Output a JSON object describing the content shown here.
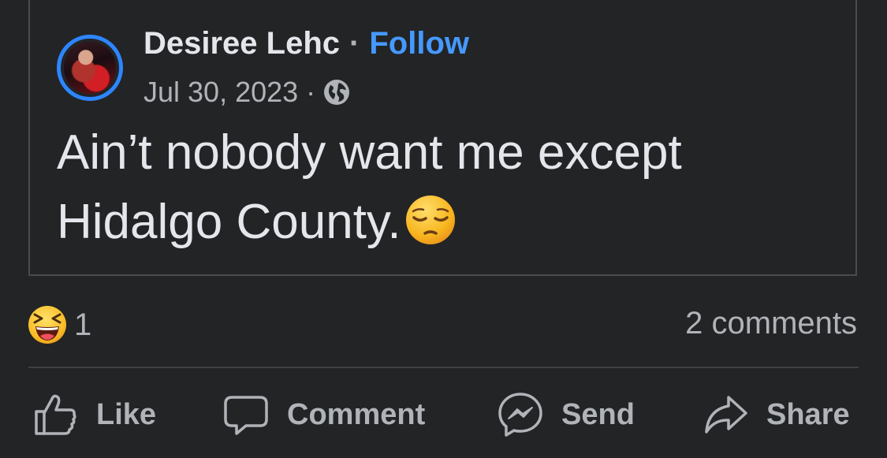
{
  "post": {
    "author": "Desiree Lehc",
    "separator": "·",
    "follow_label": "Follow",
    "date": "Jul 30, 2023",
    "privacy_icon": "globe-icon",
    "text": "Ain’t nobody want me except Hidalgo County.",
    "text_emoji": "pensive-face-emoji"
  },
  "engagement": {
    "reaction_icon": "laughing-face-emoji",
    "reaction_count": "1",
    "comments": "2 comments"
  },
  "actions": {
    "like": "Like",
    "comment": "Comment",
    "send": "Send",
    "share": "Share"
  },
  "colors": {
    "background": "#232426",
    "accent": "#4599ff",
    "avatar_ring": "#2d86ff",
    "secondary_text": "#b0b3b8",
    "primary_text": "#e4e6eb"
  }
}
